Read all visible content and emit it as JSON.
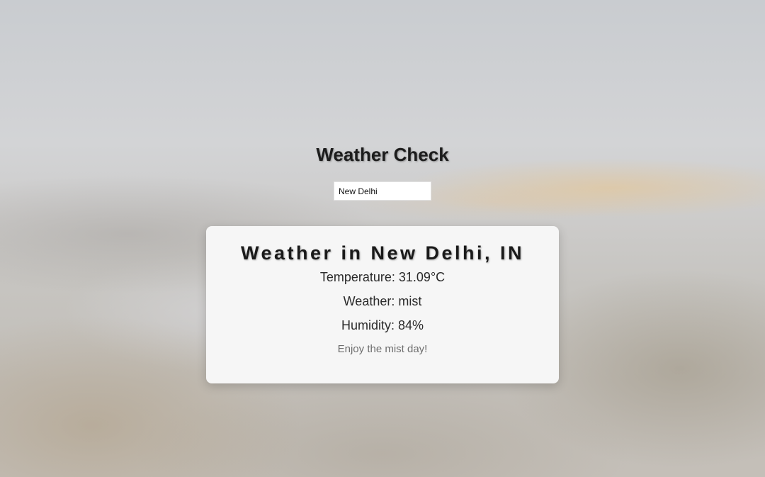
{
  "page": {
    "title": "Weather Check"
  },
  "search": {
    "value": "New Delhi"
  },
  "result": {
    "heading": "Weather in New Delhi, IN",
    "temperature": "Temperature: 31.09°C",
    "weather": "Weather: mist",
    "humidity": "Humidity: 84%",
    "message": "Enjoy the mist day!"
  },
  "colors": {
    "card_background": "#f6f6f6",
    "heading_text": "#1a1a1a",
    "message_text": "#6d6d6d"
  }
}
